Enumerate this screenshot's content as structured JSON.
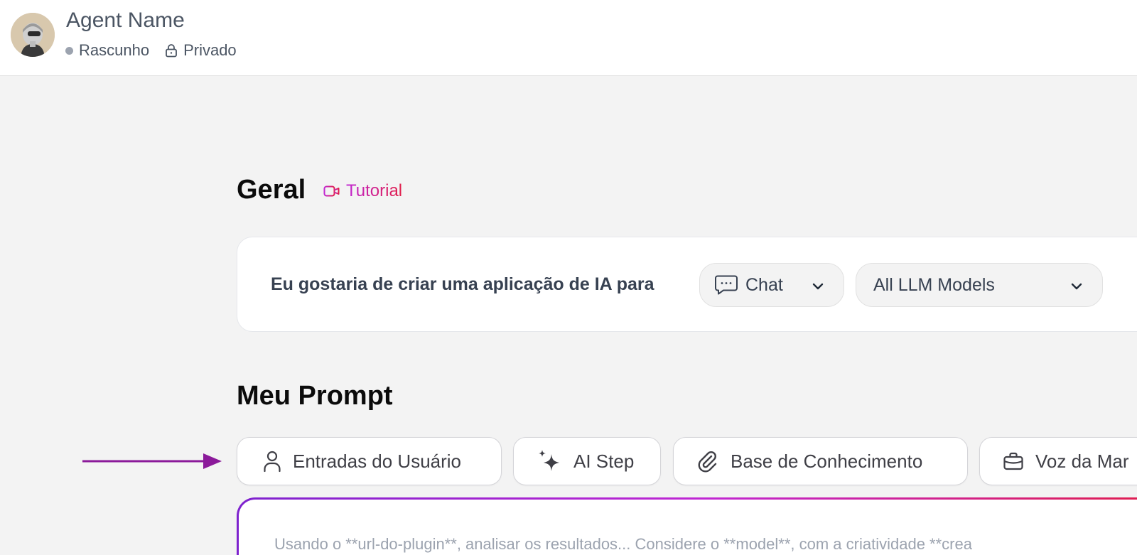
{
  "header": {
    "agent_name": "Agent Name",
    "status": "Rascunho",
    "visibility": "Privado"
  },
  "general": {
    "title": "Geral",
    "tutorial_label": "Tutorial",
    "card_label": "Eu gostaria de criar uma aplicação de IA para",
    "app_type_value": "Chat",
    "model_value": "All LLM Models"
  },
  "prompt": {
    "title": "Meu Prompt",
    "chips": [
      {
        "label": "Entradas do Usuário",
        "icon": "user-icon"
      },
      {
        "label": "AI Step",
        "icon": "sparkles-icon"
      },
      {
        "label": "Base de Conhecimento",
        "icon": "paperclip-icon"
      },
      {
        "label": "Voz da Mar",
        "icon": "briefcase-icon"
      }
    ],
    "placeholder": "Usando o **url-do-plugin**, analisar os resultados... Considere o **model**, com a criatividade **crea"
  },
  "colors": {
    "accent_purple": "#7e22ce",
    "accent_magenta": "#c026d3",
    "accent_red": "#e11d48",
    "arrow": "#8b1a9a"
  }
}
